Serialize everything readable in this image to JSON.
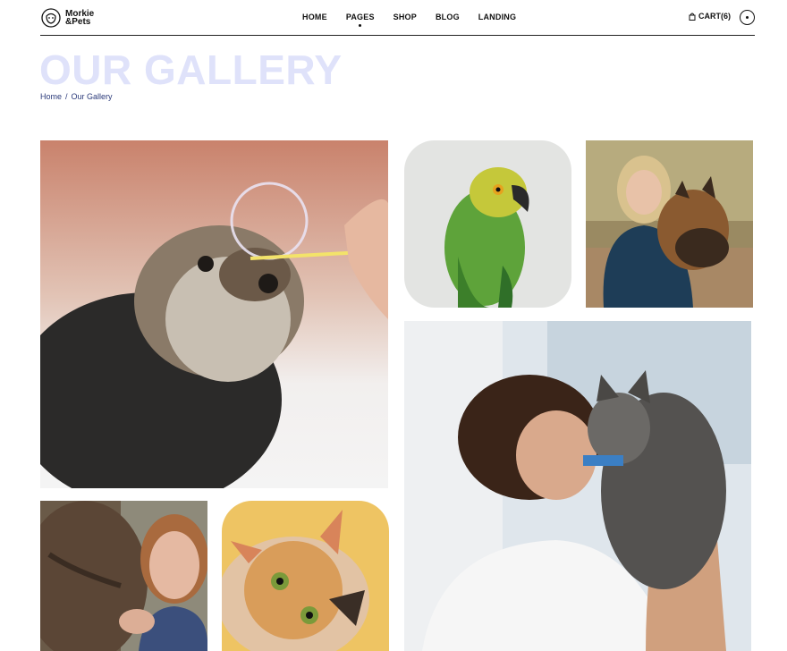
{
  "brand": {
    "line1": "Morkie",
    "line2": "&Pets"
  },
  "nav": {
    "items": [
      {
        "label": "HOME"
      },
      {
        "label": "PAGES"
      },
      {
        "label": "SHOP"
      },
      {
        "label": "BLOG"
      },
      {
        "label": "LANDING"
      }
    ]
  },
  "cart": {
    "label": "CART(6)"
  },
  "page": {
    "title": "OUR GALLERY"
  },
  "breadcrumb": {
    "home": "Home",
    "separator": "/",
    "current": "Our Gallery"
  },
  "gallery": {
    "images": [
      {
        "subject": "dog-with-bubble"
      },
      {
        "subject": "green-parrot"
      },
      {
        "subject": "woman-with-shepherd-dog"
      },
      {
        "subject": "woman-kissing-cat"
      },
      {
        "subject": "woman-with-horse"
      },
      {
        "subject": "kitten-on-yellow"
      }
    ]
  },
  "colors": {
    "title": "#dfe2fa",
    "breadcrumb": "#2b3a7a",
    "text": "#111111"
  }
}
